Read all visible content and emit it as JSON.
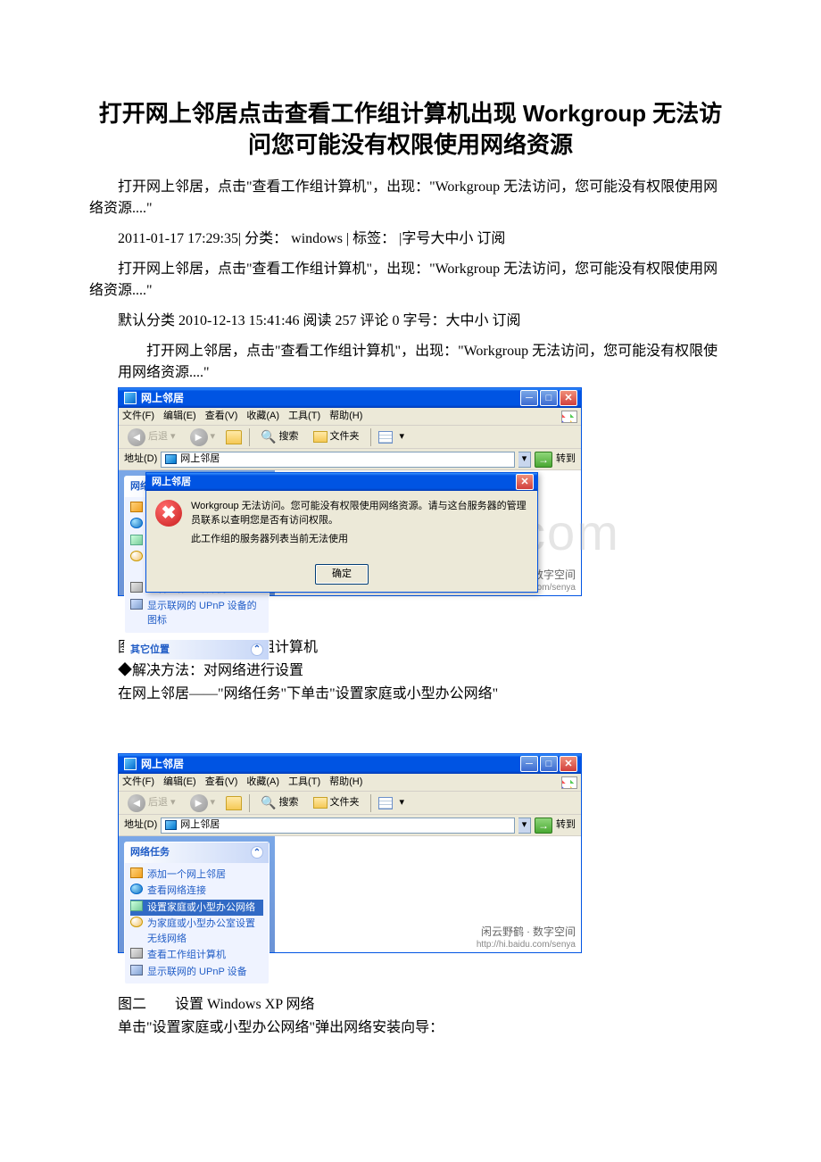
{
  "title": "打开网上邻居点击查看工作组计算机出现 Workgroup 无法访问您可能没有权限使用网络资源",
  "p1": "打开网上邻居，点击\"查看工作组计算机\"，出现：\"Workgroup 无法访问，您可能没有权限使用网络资源....\"",
  "p2": "2011-01-17 17:29:35|  分类：  windows |  标签：  |字号大中小 订阅",
  "p3": "打开网上邻居，点击\"查看工作组计算机\"，出现：\"Workgroup 无法访问，您可能没有权限使用网络资源....\"",
  "p4": "默认分类 2010-12-13 15:41:46 阅读 257 评论 0   字号：大中小 订阅",
  "block1_intro": "打开网上邻居，点击\"查看工作组计算机\"，出现：\"Workgroup 无法访问，您可能没有权限使用网络资源....\"",
  "xp": {
    "window_title": "网上邻居",
    "menu": [
      "文件(F)",
      "编辑(E)",
      "查看(V)",
      "收藏(A)",
      "工具(T)",
      "帮助(H)"
    ],
    "back": "后退",
    "search": "搜索",
    "folders": "文件夹",
    "addr_label": "地址(D)",
    "addr_value": "网上邻居",
    "go": "转到",
    "panel_title_tasks": "网络任务",
    "panel_title_other": "其它位置",
    "tasks": {
      "add": "添加一个网上邻居",
      "view": "查看网络连接",
      "setup": "设置家庭或小型办公网络",
      "wireless": "为家庭或小型办公室设置无线网络",
      "workgroup": "查看工作组计算机",
      "upnp": "显示联网的 UPnP 设备的图标",
      "upnp2": "显示联网的 UPnP 设备"
    }
  },
  "dialog": {
    "title": "网上邻居",
    "line1": "Workgroup 无法访问。您可能没有权限使用网络资源。请与这台服务器的管理员联系以查明您是否有访问权限。",
    "line2": "此工作组的服务器列表当前无法使用",
    "ok": "确定"
  },
  "wm_text": "闲云野鹤 · 数字空间",
  "wm_url": "http://hi.baidu.com/senya",
  "bg_wm": "www.bdocx.com",
  "caption1": "图一　　无法查看工作组计算机",
  "caption1b": "◆解决方法：对网络进行设置",
  "caption1c": "在网上邻居——\"网络任务\"下单击\"设置家庭或小型办公网络\"",
  "caption2": "图二　　设置 Windows XP 网络",
  "caption2b": "单击\"设置家庭或小型办公网络\"弹出网络安装向导："
}
